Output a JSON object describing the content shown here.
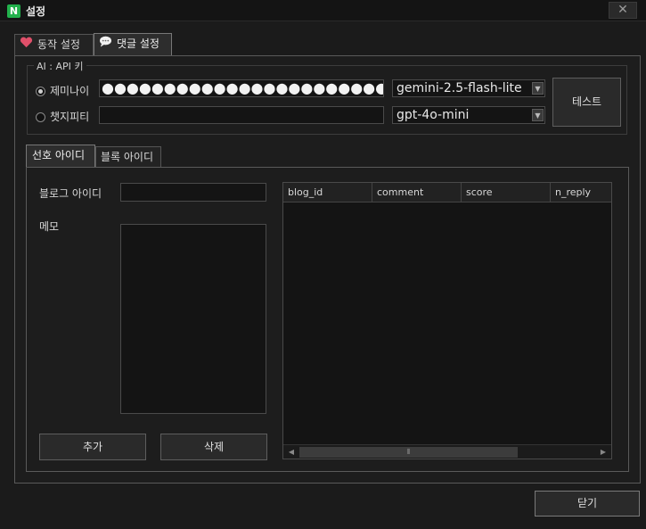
{
  "window": {
    "title": "설정",
    "app_icon_letter": "N",
    "close_symbol": "✕"
  },
  "tabs": [
    {
      "label": "동작 설정",
      "icon": "heart-icon",
      "active": false
    },
    {
      "label": "댓글 설정",
      "icon": "chat-bubble-icon",
      "active": true
    }
  ],
  "ai_group": {
    "title": "AI : API 키",
    "providers": [
      {
        "label": "제미나이",
        "checked": true,
        "key_masked": "●●●●●●●●●●●●●●●●●●●●●●●●",
        "model": "gemini-2.5-flash-lite"
      },
      {
        "label": "챗지피티",
        "checked": false,
        "key_masked": "",
        "model": "gpt-4o-mini"
      }
    ],
    "test_button": "테스트"
  },
  "inner_tabs": [
    {
      "label": "선호 아이디",
      "active": true
    },
    {
      "label": "블록 아이디",
      "active": false
    }
  ],
  "form": {
    "blog_id_label": "블로그 아이디",
    "blog_id_value": "",
    "memo_label": "메모",
    "memo_value": "",
    "add_button": "추가",
    "delete_button": "삭제"
  },
  "table": {
    "columns": [
      "blog_id",
      "comment",
      "score",
      "n_reply"
    ],
    "rows": []
  },
  "footer": {
    "close_button": "닫기"
  },
  "colors": {
    "background": "#1b1b1b",
    "border": "#5a5a5a",
    "app_icon": "#22b14c",
    "heart": "#e0506a"
  }
}
